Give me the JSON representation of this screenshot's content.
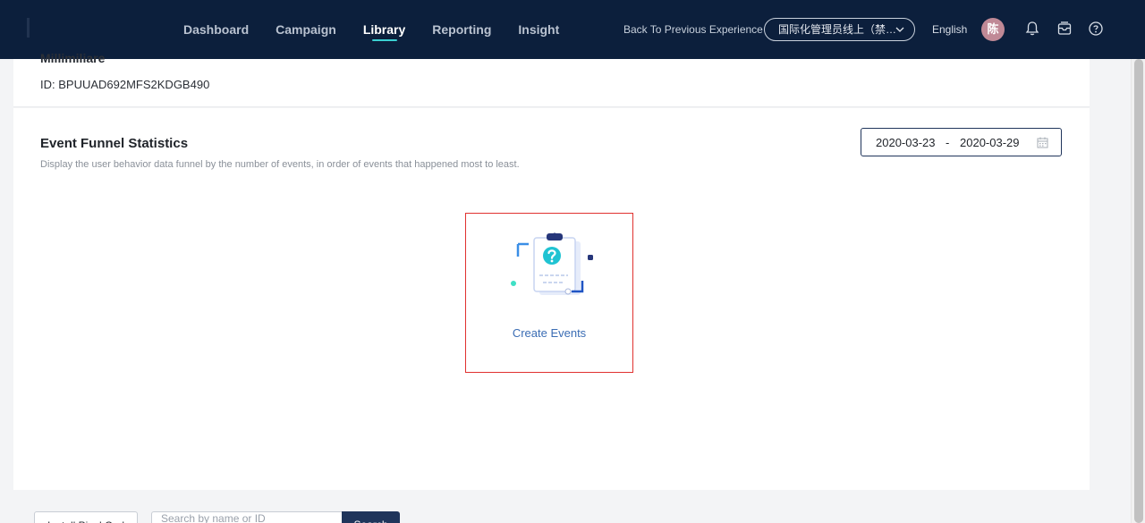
{
  "topbar": {
    "nav": [
      {
        "label": "Dashboard",
        "active": false
      },
      {
        "label": "Campaign",
        "active": false
      },
      {
        "label": "Library",
        "active": true
      },
      {
        "label": "Reporting",
        "active": false
      },
      {
        "label": "Insight",
        "active": false
      }
    ],
    "back_label": "Back To Previous Experience",
    "org_select": "国际化管理员线上（禁…",
    "language": "English",
    "avatar_char": "陈",
    "icons": [
      "bell-icon",
      "inbox-icon",
      "help-icon"
    ]
  },
  "detail": {
    "title": "Millimiliare",
    "id_label": "ID: BPUUAD692MFS2KDGB490"
  },
  "funnel": {
    "title": "Event Funnel Statistics",
    "description": "Display the user behavior data funnel by the number of events, in order of events that happened most to least.",
    "date_start": "2020-03-23",
    "date_sep": "-",
    "date_end": "2020-03-29",
    "empty_action": "Create Events"
  },
  "bottom": {
    "button_label": "Install Pixel Code",
    "search_placeholder": "Search by name or ID",
    "search_button": "Search"
  },
  "colors": {
    "topbar": "#0c1f3c",
    "accent": "#3bd0d2",
    "link": "#3b6db4",
    "highlight": "#e0312f"
  }
}
